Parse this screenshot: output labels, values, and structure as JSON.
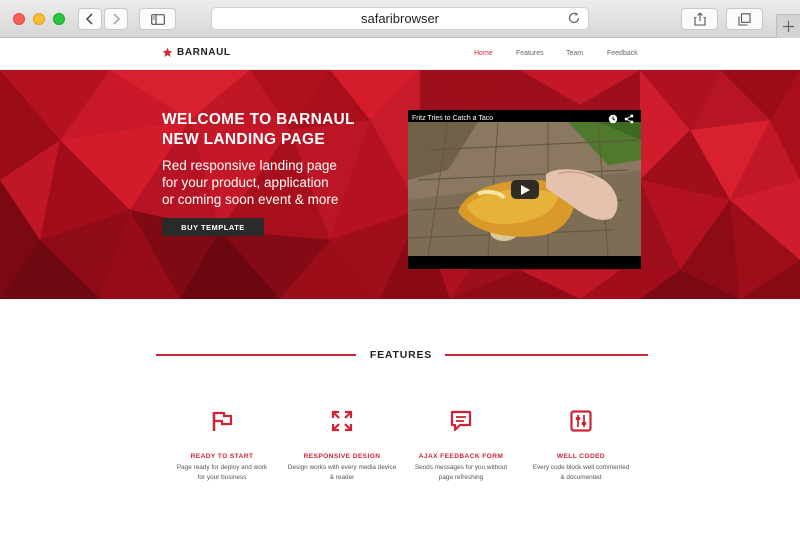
{
  "browser": {
    "address": "safaribrowser",
    "icons": [
      "back-icon",
      "forward-icon",
      "sidebar-icon",
      "reload-icon",
      "share-icon",
      "tabs-icon",
      "plus-icon"
    ]
  },
  "site": {
    "brand": "BARNAUL",
    "nav": [
      "Home",
      "Features",
      "Team",
      "Feedback"
    ],
    "active_nav": "Home",
    "accent": "#d12c3d"
  },
  "hero": {
    "title_line1": "WELCOME TO BARNAUL",
    "title_line2": "NEW LANDING PAGE",
    "sub_line1": "Red responsive landing page",
    "sub_line2": "for your product, application",
    "sub_line3": "or coming soon event & more",
    "button": "BUY TEMPLATE",
    "video": {
      "title": "Fritz Tries to Catch a Taco"
    }
  },
  "features": {
    "heading": "FEATURES",
    "items": [
      {
        "icon": "flag-icon",
        "title": "READY TO START",
        "line1": "Page ready for deploy and work",
        "line2": "for your business"
      },
      {
        "icon": "expand-icon",
        "title": "RESPONSIVE DESIGN",
        "line1": "Design works with every media device",
        "line2": "& reader"
      },
      {
        "icon": "chat-icon",
        "title": "AJAX FEEDBACK FORM",
        "line1": "Sends messages for you without",
        "line2": "page refreshing"
      },
      {
        "icon": "sliders-icon",
        "title": "WELL CODED",
        "line1": "Every code block well commented",
        "line2": "& documented"
      }
    ]
  }
}
